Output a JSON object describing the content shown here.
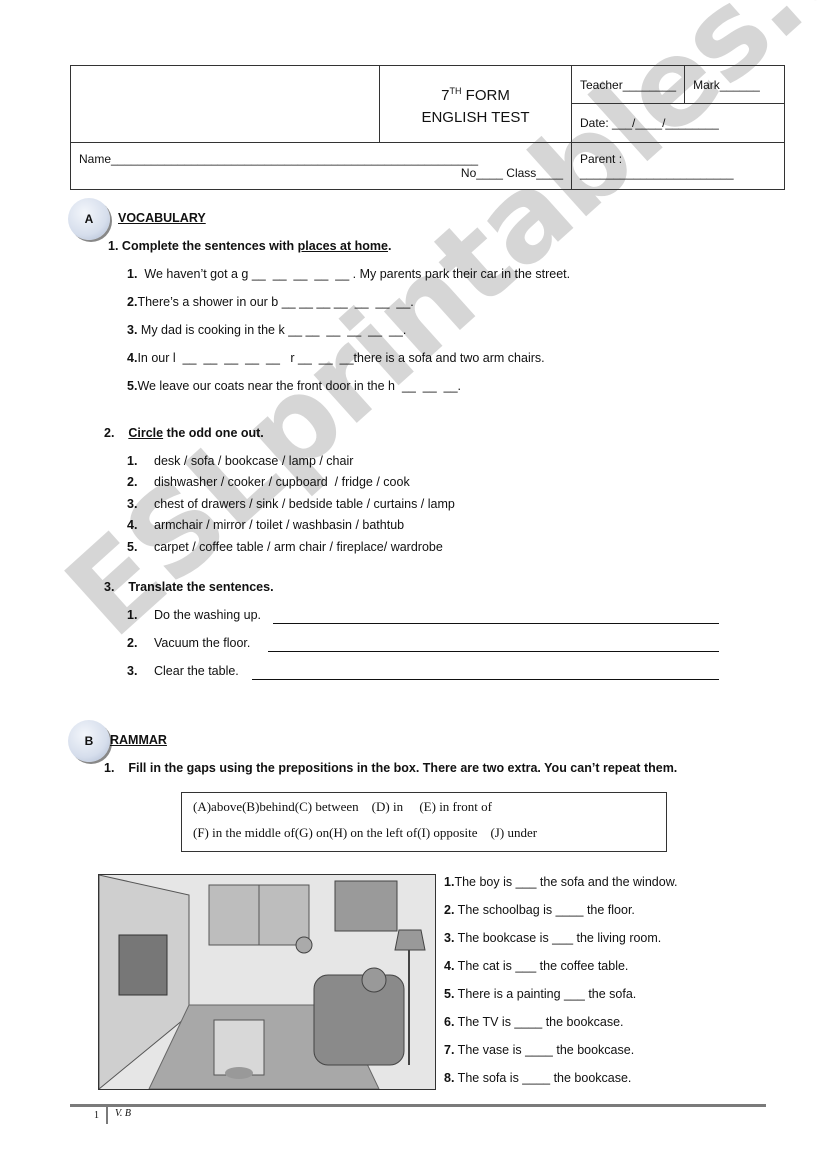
{
  "watermark": "ESLprintables.com",
  "header": {
    "title_grade": "7",
    "title_sup": "TH",
    "title_form": " FORM",
    "title_test": "ENGLISH TEST",
    "teacher": "Teacher________",
    "mark": "Mark______",
    "date": "Date: ___/____/________",
    "name": "Name_______________________________________________________",
    "no_class": "No____ Class____",
    "parent": "Parent : _______________________"
  },
  "section_a": {
    "badge": "A",
    "title": "VOCABULARY",
    "q1": {
      "number": "1.",
      "text_before": " Complete the sentences with ",
      "underlined": "places at home",
      "text_after": ".",
      "items": [
        {
          "num": "1.",
          "text": "  We haven’t got a g __  __  __  __  __ . My parents park their car in the street."
        },
        {
          "num": "2.",
          "text": "There’s a shower in our b __ __ __ __  __  __  __."
        },
        {
          "num": "3.",
          "text": " My dad is cooking in the k __ __  __  __  __  __."
        },
        {
          "num": "4.",
          "text": "In our l  __  __  __  __  __   r __  __  __there is a sofa and two arm chairs."
        },
        {
          "num": "5.",
          "text": "We leave our coats near the front door in the h  __  __  __."
        }
      ]
    },
    "q2": {
      "number": "2.",
      "underlined": "Circle",
      "text": " the odd one out.",
      "items": [
        {
          "num": "1.",
          "text": "desk / sofa / bookcase / lamp / chair"
        },
        {
          "num": "2.",
          "text": "dishwasher / cooker / cupboard  / fridge / cook"
        },
        {
          "num": "3.",
          "text": "chest of drawers / sink / bedside table / curtains / lamp"
        },
        {
          "num": "4.",
          "text": "armchair / mirror / toilet / washbasin / bathtub"
        },
        {
          "num": "5.",
          "text": "carpet / coffee table / arm chair / fireplace/ wardrobe"
        }
      ]
    },
    "q3": {
      "number": "3.",
      "text": "Translate the sentences.",
      "items": [
        {
          "num": "1.",
          "text": "Do the washing up."
        },
        {
          "num": "2.",
          "text": "Vacuum the floor."
        },
        {
          "num": "3.",
          "text": "Clear the table."
        }
      ]
    }
  },
  "section_b": {
    "badge": "B",
    "title": "RAMMAR",
    "q1": {
      "number": "1.",
      "text": "Fill in the gaps using the prepositions in the box. There are two extra. You can’t repeat them."
    },
    "prepositions_row1": "(A)above(B)behind(C) between    (D) in     (E) in front of",
    "prepositions_row2": "(F) in the middle of(G) on(H) on the left of(I) opposite    (J) under",
    "picture_alt": "living room illustration",
    "items": [
      {
        "num": "1.",
        "text": "The boy is ___ the sofa and the window."
      },
      {
        "num": "2.",
        "text": " The schoolbag is ____ the floor."
      },
      {
        "num": "3.",
        "text": " The bookcase is ___ the living room."
      },
      {
        "num": "4.",
        "text": " The cat is ___ the coffee table."
      },
      {
        "num": "5.",
        "text": " There is a painting ___ the sofa."
      },
      {
        "num": "6.",
        "text": " The TV is ____ the bookcase."
      },
      {
        "num": "7.",
        "text": " The vase is ____ the bookcase."
      },
      {
        "num": "8.",
        "text": " The sofa is ____ the bookcase."
      }
    ]
  },
  "footer": {
    "page_number": "1",
    "author": "V. B"
  }
}
